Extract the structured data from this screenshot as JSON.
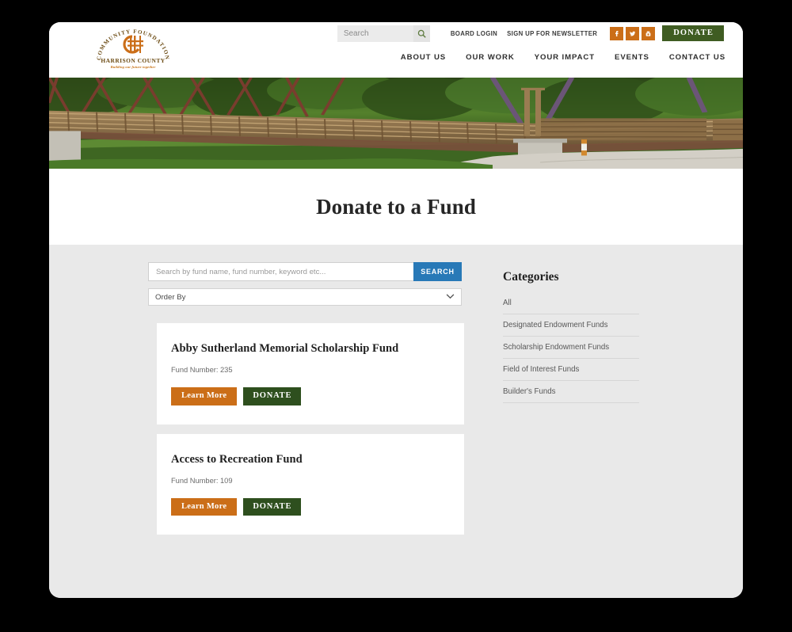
{
  "header": {
    "logo": {
      "arc_text": "COMMUNITY FOUNDATION",
      "name": "HARRISON COUNTY",
      "tagline": "Building our future together",
      "mark": "cfhc-monogram-icon"
    },
    "search": {
      "placeholder": "Search",
      "value": "",
      "icon": "search-icon"
    },
    "util_links": [
      {
        "label": "BOARD LOGIN"
      },
      {
        "label": "SIGN UP FOR NEWSLETTER"
      }
    ],
    "social": [
      {
        "name": "facebook-icon",
        "glyph": "f"
      },
      {
        "name": "twitter-icon",
        "glyph": "t"
      },
      {
        "name": "youtube-icon",
        "glyph": "y"
      }
    ],
    "donate_label": "DONATE",
    "nav": [
      {
        "label": "ABOUT US"
      },
      {
        "label": "OUR WORK"
      },
      {
        "label": "YOUR IMPACT"
      },
      {
        "label": "EVENTS"
      },
      {
        "label": "CONTACT US"
      }
    ]
  },
  "hero": {
    "alt": "Wooden pedestrian truss bridge over green trees and a paved trail"
  },
  "page": {
    "title": "Donate to a Fund"
  },
  "funds_panel": {
    "search": {
      "placeholder": "Search by fund name, fund number, keyword etc...",
      "value": "",
      "button_label": "SEARCH"
    },
    "order_by": {
      "selected": "Order By",
      "options": [
        "Order By"
      ],
      "chevron": "chevron-down-icon"
    },
    "cards": [
      {
        "title": "Abby Sutherland Memorial Scholarship Fund",
        "fund_number": "Fund Number: 235",
        "learn_more_label": "Learn More",
        "donate_label": "DONATE"
      },
      {
        "title": "Access to Recreation Fund",
        "fund_number": "Fund Number: 109",
        "learn_more_label": "Learn More",
        "donate_label": "DONATE"
      }
    ]
  },
  "sidebar": {
    "title": "Categories",
    "items": [
      {
        "label": "All"
      },
      {
        "label": "Designated Endowment Funds"
      },
      {
        "label": "Scholarship Endowment Funds"
      },
      {
        "label": "Field of Interest Funds"
      },
      {
        "label": "Builder's Funds"
      }
    ]
  },
  "colors": {
    "orange": "#cb6e18",
    "green": "#2e4f1e",
    "header_green": "#3f5c22",
    "blue": "#2879b7",
    "content_bg": "#e9e9e9"
  }
}
